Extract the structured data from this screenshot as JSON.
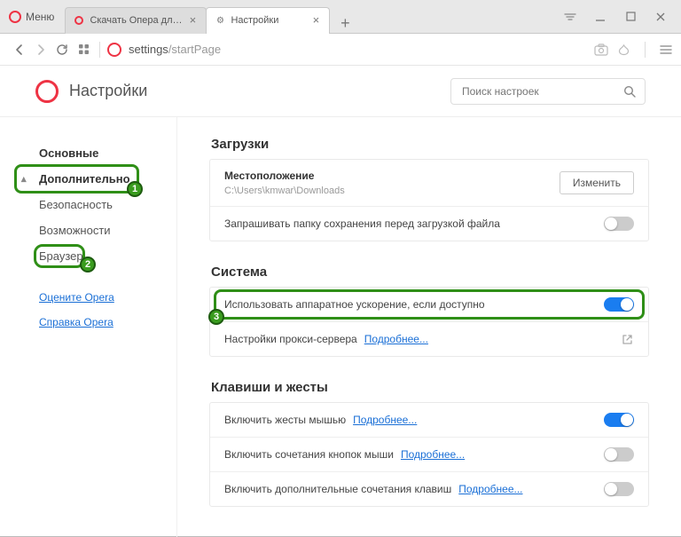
{
  "titlebar": {
    "menu_label": "Меню",
    "tabs": [
      {
        "label": "Скачать Опера для комп",
        "active": false,
        "icon": "opera"
      },
      {
        "label": "Настройки",
        "active": true,
        "icon": "gear"
      }
    ],
    "newtab_glyph": "+"
  },
  "address": {
    "prefix": "settings",
    "suffix": "/startPage"
  },
  "page": {
    "title": "Настройки",
    "search_placeholder": "Поиск настроек"
  },
  "sidebar": {
    "items": [
      {
        "label": "Основные",
        "bold": true
      },
      {
        "label": "Дополнительно",
        "bold": true,
        "expanded": true,
        "badge": "1"
      },
      {
        "label": "Безопасность"
      },
      {
        "label": "Возможности"
      },
      {
        "label": "Браузер",
        "badge": "2"
      }
    ],
    "links": [
      {
        "label": "Оцените Opera"
      },
      {
        "label": "Справка Opera"
      }
    ]
  },
  "sections": {
    "downloads": {
      "title": "Загрузки",
      "location_label": "Местоположение",
      "location_path": "C:\\Users\\kmwar\\Downloads",
      "change_button": "Изменить",
      "ask_label": "Запрашивать папку сохранения перед загрузкой файла",
      "ask_on": false
    },
    "system": {
      "title": "Система",
      "hw_label": "Использовать аппаратное ускорение, если доступно",
      "hw_on": true,
      "hw_badge": "3",
      "proxy_label": "Настройки прокси-сервера",
      "learn_more": "Подробнее..."
    },
    "gestures": {
      "title": "Клавиши и жесты",
      "rows": [
        {
          "label": "Включить жесты мышью",
          "link": "Подробнее...",
          "on": true
        },
        {
          "label": "Включить сочетания кнопок мыши",
          "link": "Подробнее...",
          "on": false
        },
        {
          "label": "Включить дополнительные сочетания клавиш",
          "link": "Подробнее...",
          "on": false
        }
      ]
    }
  }
}
